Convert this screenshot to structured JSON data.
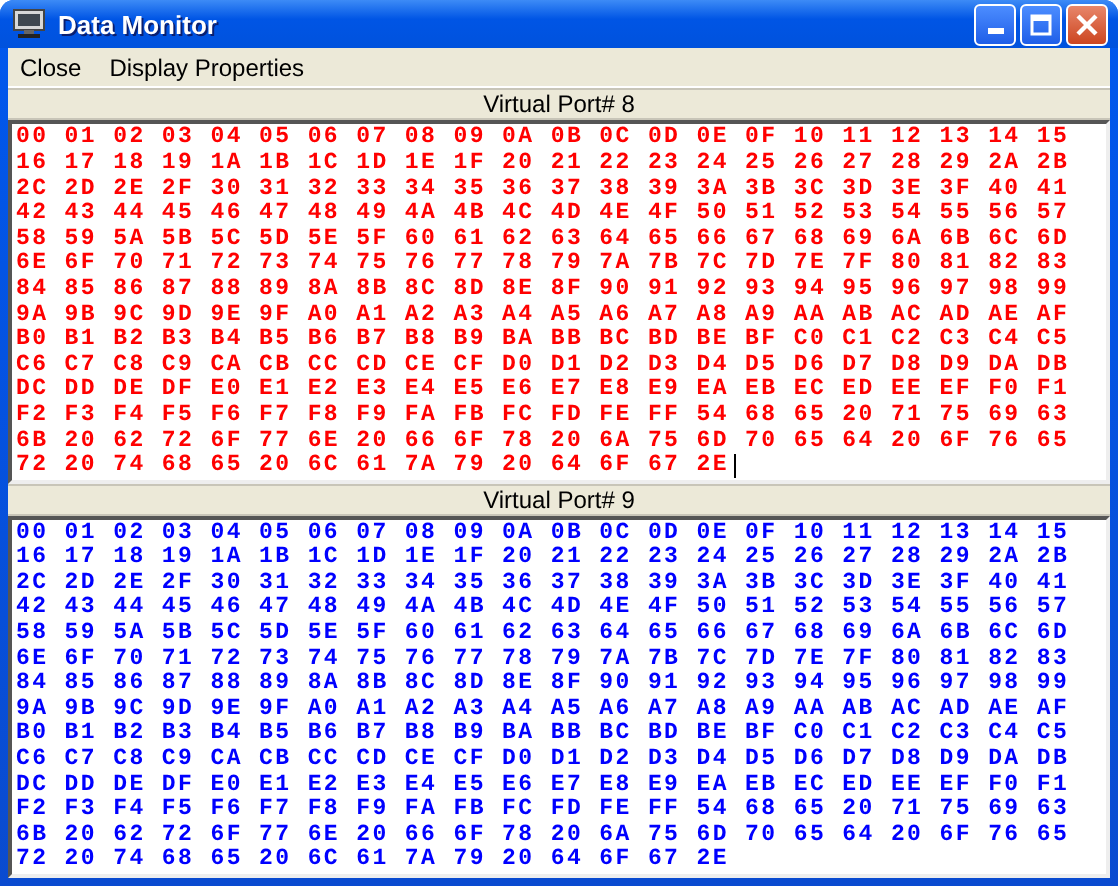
{
  "window": {
    "title": "Data Monitor"
  },
  "menu": [
    "Close",
    "Display Properties"
  ],
  "ports": [
    {
      "title": "Virtual Port# 8",
      "color": "#ff0000",
      "caret": true,
      "lines": [
        "00 01 02 03 04 05 06 07 08 09 0A 0B 0C 0D 0E 0F 10 11 12 13 14 15",
        "16 17 18 19 1A 1B 1C 1D 1E 1F 20 21 22 23 24 25 26 27 28 29 2A 2B",
        "2C 2D 2E 2F 30 31 32 33 34 35 36 37 38 39 3A 3B 3C 3D 3E 3F 40 41",
        "42 43 44 45 46 47 48 49 4A 4B 4C 4D 4E 4F 50 51 52 53 54 55 56 57",
        "58 59 5A 5B 5C 5D 5E 5F 60 61 62 63 64 65 66 67 68 69 6A 6B 6C 6D",
        "6E 6F 70 71 72 73 74 75 76 77 78 79 7A 7B 7C 7D 7E 7F 80 81 82 83",
        "84 85 86 87 88 89 8A 8B 8C 8D 8E 8F 90 91 92 93 94 95 96 97 98 99",
        "9A 9B 9C 9D 9E 9F A0 A1 A2 A3 A4 A5 A6 A7 A8 A9 AA AB AC AD AE AF",
        "B0 B1 B2 B3 B4 B5 B6 B7 B8 B9 BA BB BC BD BE BF C0 C1 C2 C3 C4 C5",
        "C6 C7 C8 C9 CA CB CC CD CE CF D0 D1 D2 D3 D4 D5 D6 D7 D8 D9 DA DB",
        "DC DD DE DF E0 E1 E2 E3 E4 E5 E6 E7 E8 E9 EA EB EC ED EE EF F0 F1",
        "F2 F3 F4 F5 F6 F7 F8 F9 FA FB FC FD FE FF 54 68 65 20 71 75 69 63",
        "6B 20 62 72 6F 77 6E 20 66 6F 78 20 6A 75 6D 70 65 64 20 6F 76 65",
        "72 20 74 68 65 20 6C 61 7A 79 20 64 6F 67 2E"
      ]
    },
    {
      "title": "Virtual Port# 9",
      "color": "#0000ff",
      "caret": false,
      "lines": [
        "00 01 02 03 04 05 06 07 08 09 0A 0B 0C 0D 0E 0F 10 11 12 13 14 15",
        "16 17 18 19 1A 1B 1C 1D 1E 1F 20 21 22 23 24 25 26 27 28 29 2A 2B",
        "2C 2D 2E 2F 30 31 32 33 34 35 36 37 38 39 3A 3B 3C 3D 3E 3F 40 41",
        "42 43 44 45 46 47 48 49 4A 4B 4C 4D 4E 4F 50 51 52 53 54 55 56 57",
        "58 59 5A 5B 5C 5D 5E 5F 60 61 62 63 64 65 66 67 68 69 6A 6B 6C 6D",
        "6E 6F 70 71 72 73 74 75 76 77 78 79 7A 7B 7C 7D 7E 7F 80 81 82 83",
        "84 85 86 87 88 89 8A 8B 8C 8D 8E 8F 90 91 92 93 94 95 96 97 98 99",
        "9A 9B 9C 9D 9E 9F A0 A1 A2 A3 A4 A5 A6 A7 A8 A9 AA AB AC AD AE AF",
        "B0 B1 B2 B3 B4 B5 B6 B7 B8 B9 BA BB BC BD BE BF C0 C1 C2 C3 C4 C5",
        "C6 C7 C8 C9 CA CB CC CD CE CF D0 D1 D2 D3 D4 D5 D6 D7 D8 D9 DA DB",
        "DC DD DE DF E0 E1 E2 E3 E4 E5 E6 E7 E8 E9 EA EB EC ED EE EF F0 F1",
        "F2 F3 F4 F5 F6 F7 F8 F9 FA FB FC FD FE FF 54 68 65 20 71 75 69 63",
        "6B 20 62 72 6F 77 6E 20 66 6F 78 20 6A 75 6D 70 65 64 20 6F 76 65",
        "72 20 74 68 65 20 6C 61 7A 79 20 64 6F 67 2E"
      ]
    }
  ]
}
